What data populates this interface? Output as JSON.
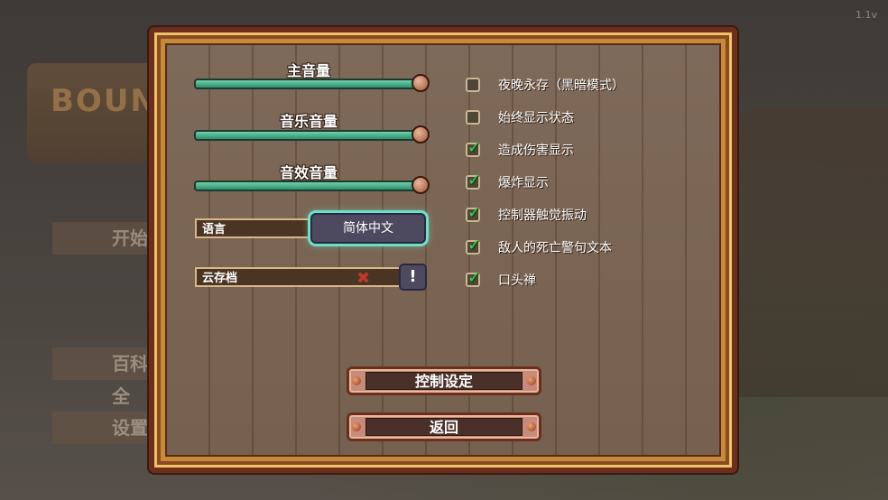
{
  "background": {
    "logo_text": "BOUN",
    "menu": [
      "开始",
      "百科全",
      "设置"
    ],
    "version": "1.1v"
  },
  "volume": [
    {
      "label": "主音量",
      "level": 1.0
    },
    {
      "label": "音乐音量",
      "level": 1.0
    },
    {
      "label": "音效音量",
      "level": 1.0
    }
  ],
  "language": {
    "label": "语言",
    "value": "简体中文"
  },
  "cloud_save": {
    "label": "云存档",
    "status_icon": "error-x-icon",
    "button": "!"
  },
  "options": [
    {
      "label": "夜晚永存（黑暗模式）",
      "checked": false
    },
    {
      "label": "始终显示状态",
      "checked": false
    },
    {
      "label": "造成伤害显示",
      "checked": true
    },
    {
      "label": "爆炸显示",
      "checked": true
    },
    {
      "label": "控制器触觉振动",
      "checked": true
    },
    {
      "label": "敌人的死亡警句文本",
      "checked": true
    },
    {
      "label": "口头禅",
      "checked": true
    }
  ],
  "buttons": {
    "controls": "控制设定",
    "back": "返回"
  },
  "colors": {
    "accent": "#6fe0c8",
    "slider": "#3aa37f",
    "frame": "#c58a3a"
  }
}
